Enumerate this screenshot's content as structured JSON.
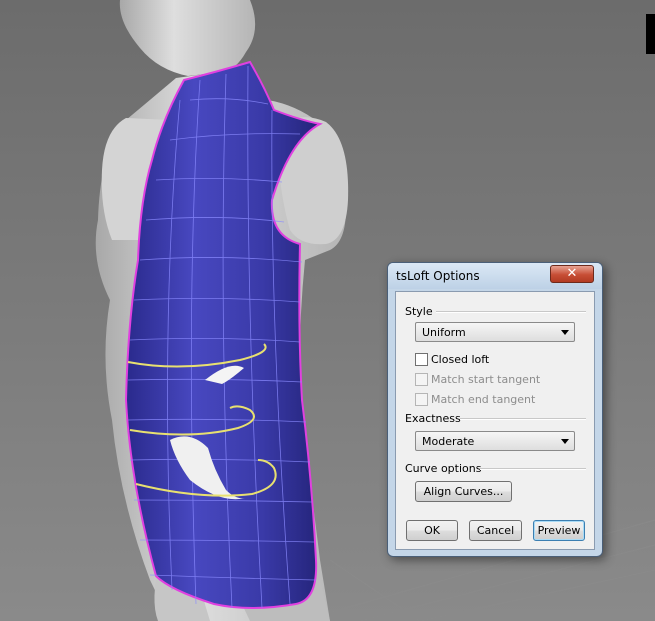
{
  "dialog": {
    "title": "tsLoft Options",
    "close_glyph": "✕",
    "style": {
      "group_label": "Style",
      "selected": "Uniform",
      "closed_loft_label": "Closed loft",
      "closed_loft_checked": false,
      "match_start_label": "Match start tangent",
      "match_start_enabled": false,
      "match_end_label": "Match end tangent",
      "match_end_enabled": false
    },
    "exactness": {
      "group_label": "Exactness",
      "selected": "Moderate"
    },
    "curve_options": {
      "group_label": "Curve options",
      "align_button": "Align Curves..."
    },
    "buttons": {
      "ok": "OK",
      "cancel": "Cancel",
      "preview": "Preview"
    }
  },
  "colors": {
    "surface": "#3f3fb4",
    "surface_edge": "#e040e0",
    "curves": "#e8e070",
    "viewport_bg": "#7a7a7a"
  }
}
